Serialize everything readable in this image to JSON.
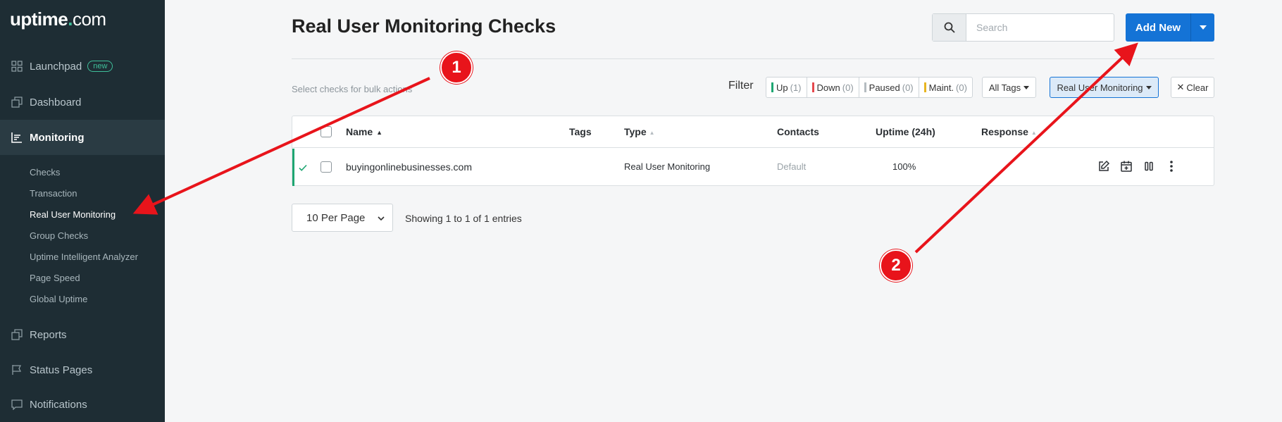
{
  "sidebar": {
    "logo": {
      "main": "uptime",
      "dot": ".",
      "suffix": "com"
    },
    "nav": {
      "launchpad": {
        "label": "Launchpad",
        "badge": "new"
      },
      "dashboard": {
        "label": "Dashboard"
      },
      "monitoring": {
        "label": "Monitoring"
      },
      "reports": {
        "label": "Reports"
      },
      "status_pages": {
        "label": "Status Pages"
      },
      "notifications": {
        "label": "Notifications"
      }
    },
    "monitoring_items": {
      "checks": "Checks",
      "transaction": "Transaction",
      "rum": "Real User Monitoring",
      "group_checks": "Group Checks",
      "analyzer": "Uptime Intelligent Analyzer",
      "page_speed": "Page Speed",
      "global_uptime": "Global Uptime"
    }
  },
  "header": {
    "title": "Real User Monitoring Checks",
    "search_placeholder": "Search",
    "add_new_label": "Add New"
  },
  "toolbar": {
    "bulk_hint": "Select checks for bulk actions",
    "filter_label": "Filter",
    "filters": {
      "up": {
        "label": "Up",
        "count": "(1)",
        "color": "#1ea672"
      },
      "down": {
        "label": "Down",
        "count": "(0)",
        "color": "#e5484d"
      },
      "paused": {
        "label": "Paused",
        "count": "(0)",
        "color": "#b5bcc1"
      },
      "maint": {
        "label": "Maint.",
        "count": "(0)",
        "color": "#e8b521"
      }
    },
    "tags_label": "All Tags",
    "type_label": "Real User Monitoring",
    "clear_label": "Clear"
  },
  "table": {
    "columns": {
      "name": "Name",
      "tags": "Tags",
      "type": "Type",
      "contacts": "Contacts",
      "uptime": "Uptime (24h)",
      "response": "Response"
    },
    "rows": [
      {
        "name": "buyingonlinebusinesses.com",
        "tags": "",
        "type": "Real User Monitoring",
        "contacts": "Default",
        "uptime": "100%",
        "response": ""
      }
    ]
  },
  "pagination": {
    "per_page": "10 Per Page",
    "showing": "Showing 1 to 1 of 1 entries"
  },
  "annotations": {
    "marker_1": "1",
    "marker_2": "2"
  },
  "colors": {
    "sidebar_bg": "#1e2d34",
    "accent_blue": "#1473d6",
    "status_green": "#1ea672",
    "annotation_red": "#e8141b"
  }
}
